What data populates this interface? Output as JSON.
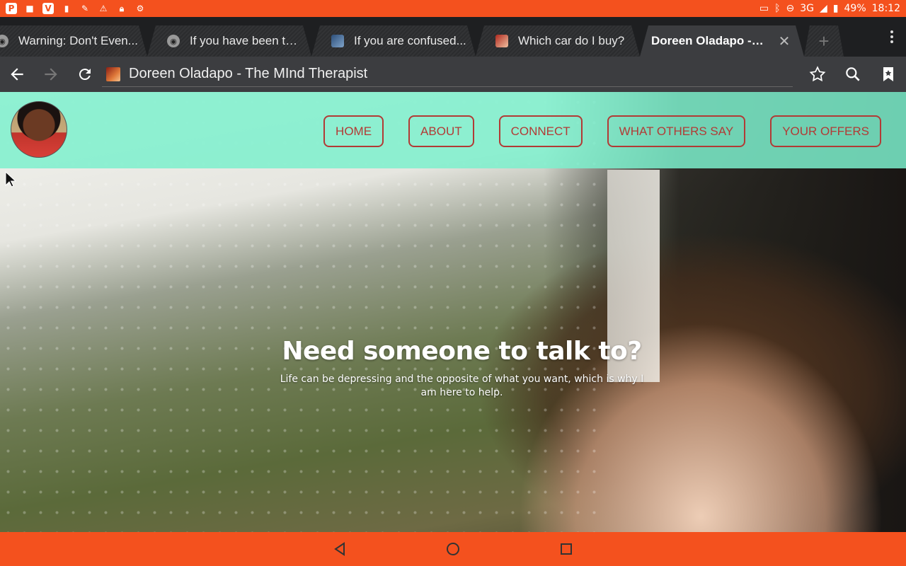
{
  "status_bar": {
    "network": "3G",
    "battery": "49%",
    "time": "18:12"
  },
  "tabs": [
    {
      "title": "Warning: Don't Even..."
    },
    {
      "title": "If you have been thin..."
    },
    {
      "title": "If you are confused..."
    },
    {
      "title": "Which car do I buy?"
    },
    {
      "title": "Doreen Oladapo - T..."
    }
  ],
  "toolbar": {
    "page_title": "Doreen Oladapo - The MInd Therapist"
  },
  "site": {
    "nav": [
      "HOME",
      "ABOUT",
      "CONNECT",
      "WHAT OTHERS SAY",
      "YOUR OFFERS"
    ],
    "hero_title": "Need someone to talk to?",
    "hero_subtitle": "Life can be depressing and the opposite of what you want, which is why I am here to help."
  },
  "colors": {
    "system_accent": "#f4511e",
    "nav_bg": "#7df0cd",
    "nav_button": "#b23a35"
  }
}
